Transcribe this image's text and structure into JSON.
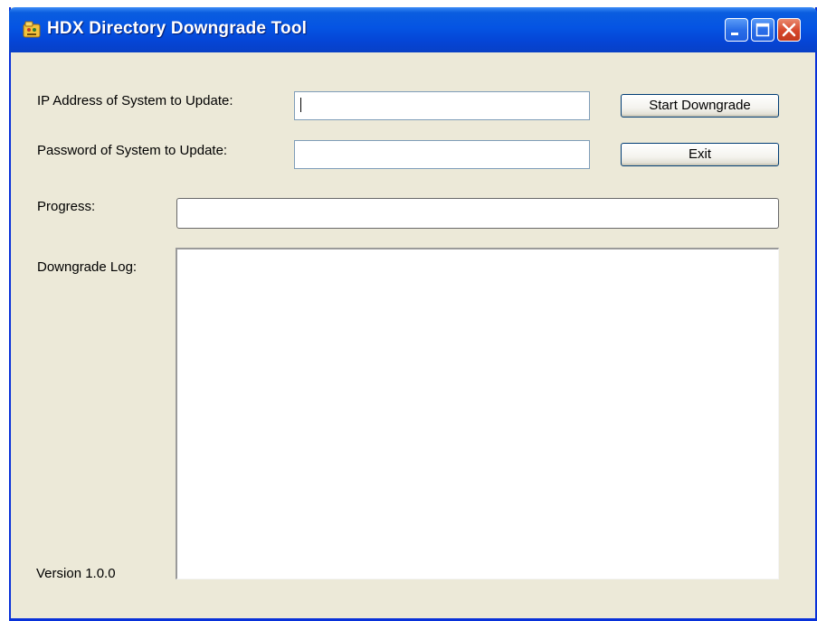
{
  "window": {
    "title": "HDX Directory Downgrade Tool",
    "controls": [
      "minimize",
      "maximize",
      "close"
    ]
  },
  "form": {
    "ip_label": "IP Address of System to Update:",
    "ip_value": "",
    "password_label": "Password of System to Update:",
    "password_value": "",
    "progress_label": "Progress:",
    "progress_value": 0,
    "log_label": "Downgrade Log:",
    "log_text": ""
  },
  "buttons": {
    "start_label": "Start Downgrade",
    "exit_label": "Exit"
  },
  "footer": {
    "version": "Version 1.0.0"
  },
  "colors": {
    "titlebar": "#0554e3",
    "window_bg": "#ece9d8",
    "close_button": "#d6462a"
  }
}
